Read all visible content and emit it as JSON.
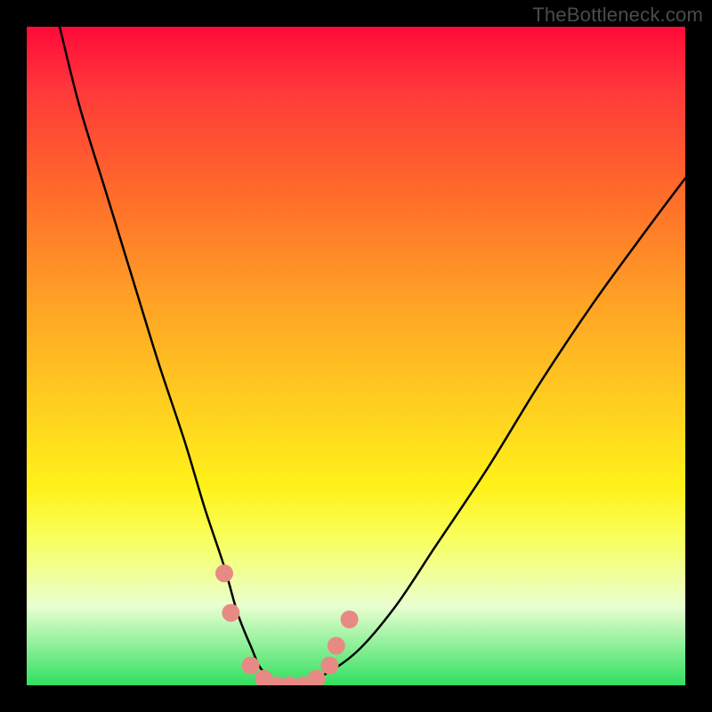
{
  "watermark": "TheBottleneck.com",
  "chart_data": {
    "type": "line",
    "title": "",
    "xlabel": "",
    "ylabel": "",
    "xlim": [
      0,
      100
    ],
    "ylim": [
      0,
      100
    ],
    "series": [
      {
        "name": "curve",
        "x": [
          5,
          8,
          12,
          16,
          20,
          24,
          27,
          30,
          32,
          34,
          36,
          40,
          44,
          50,
          56,
          62,
          70,
          78,
          86,
          94,
          100
        ],
        "y": [
          100,
          88,
          75,
          62,
          49,
          37,
          27,
          18,
          11,
          6,
          2,
          0,
          1,
          5,
          12,
          21,
          33,
          46,
          58,
          69,
          77
        ]
      }
    ],
    "markers": {
      "name": "highlight",
      "color": "#e88a84",
      "xy": [
        [
          30,
          17
        ],
        [
          31,
          11
        ],
        [
          34,
          3
        ],
        [
          36,
          1
        ],
        [
          38,
          0
        ],
        [
          40,
          0
        ],
        [
          42,
          0
        ],
        [
          44,
          1
        ],
        [
          46,
          3
        ],
        [
          47,
          6
        ],
        [
          49,
          10
        ]
      ]
    },
    "background_gradient": {
      "top": "#ff0a3a",
      "mid": "#fff21a",
      "bottom": "#30e060"
    }
  }
}
